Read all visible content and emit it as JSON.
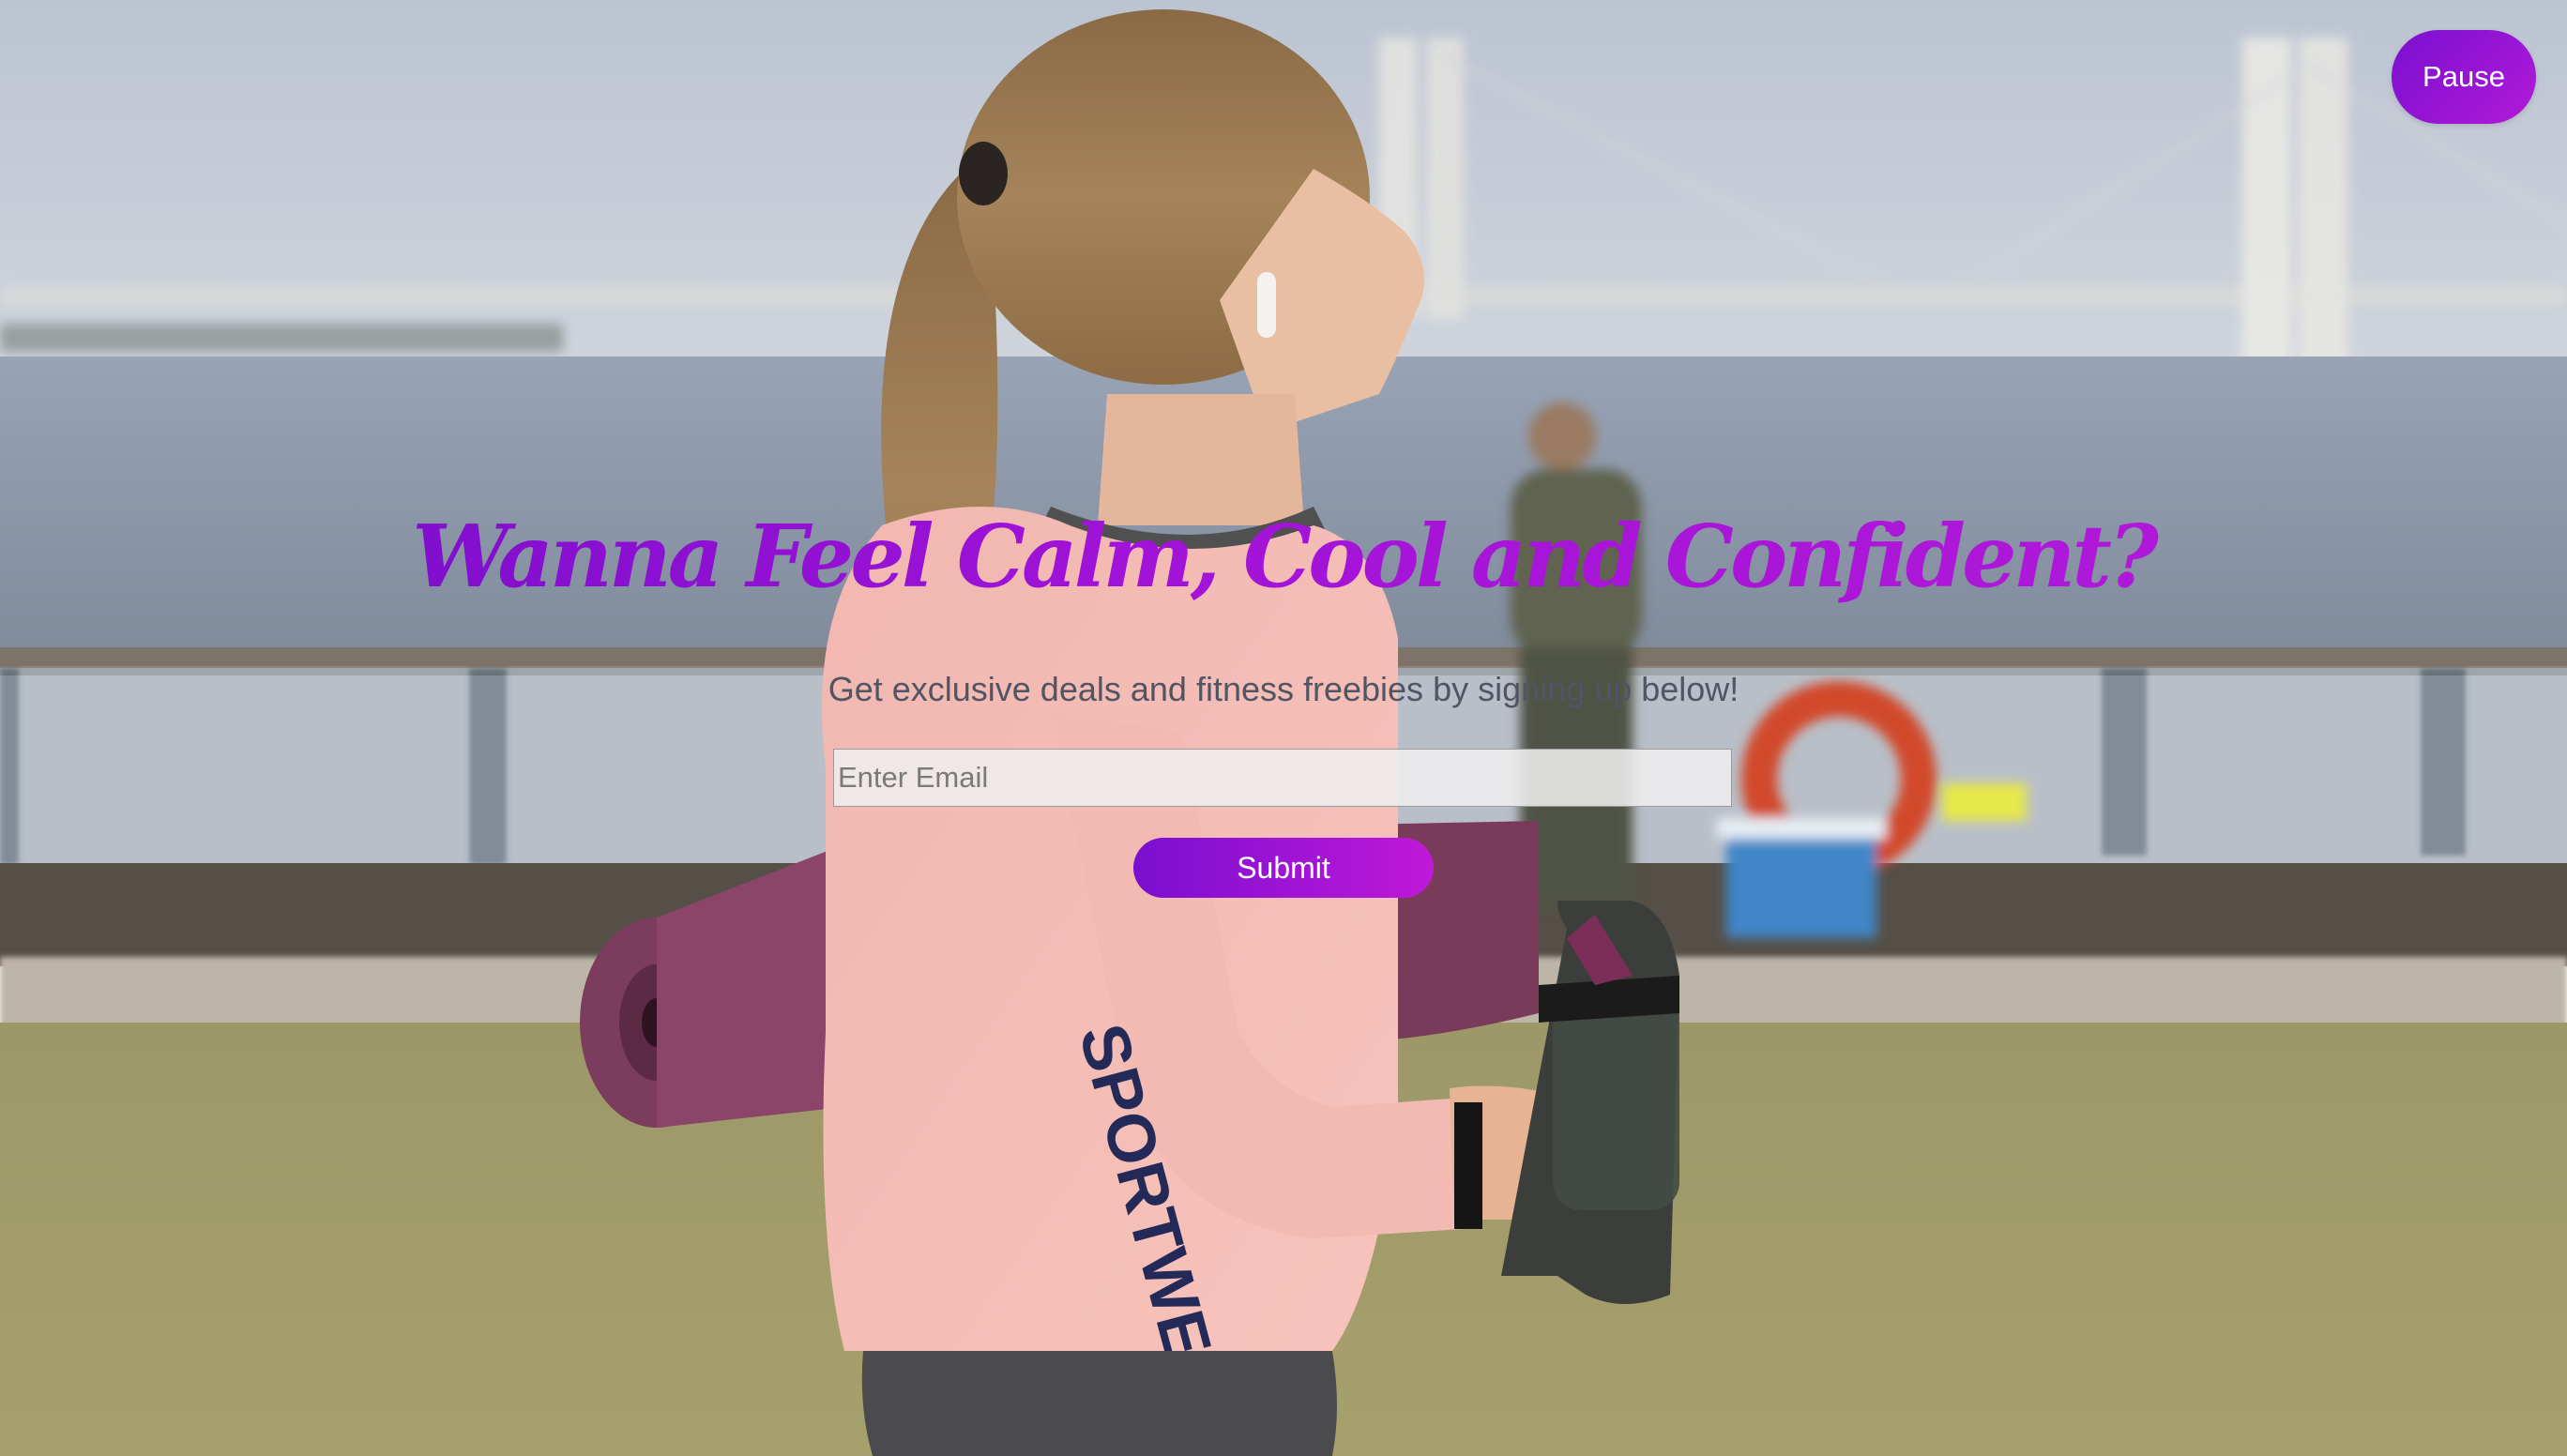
{
  "media": {
    "pause_label": "Pause"
  },
  "signup": {
    "headline": "Wanna Feel Calm, Cool and Confident?",
    "subtitle": "Get exclusive deals and fitness freebies by signing up below!",
    "email_placeholder": "Enter Email",
    "email_value": "",
    "submit_label": "Submit"
  },
  "background": {
    "description_icon": "video-background",
    "sleeve_text": "SPORTWEAR"
  },
  "colors": {
    "accent_start": "#7a0fd0",
    "accent_end": "#c018d9",
    "subtitle_text": "#505564"
  }
}
